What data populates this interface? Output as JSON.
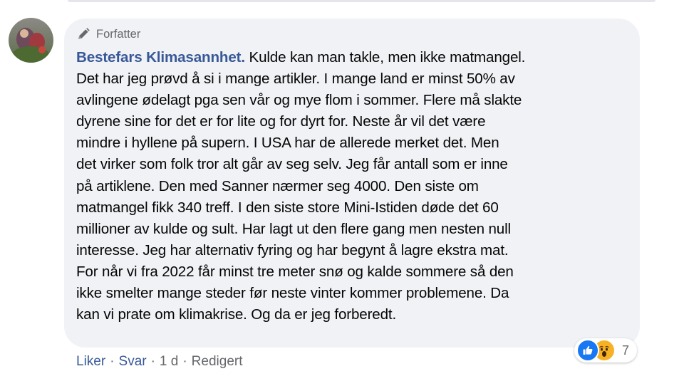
{
  "comment": {
    "badge": "Forfatter",
    "author": "Bestefars Klimasannhet.",
    "first_line_text": " Kulde kan man takle, men ikke matmangel.",
    "lines": [
      "Det har jeg prøvd å si i mange artikler. I mange land er minst 50% av",
      "avlingene ødelagt pga sen vår og mye flom i sommer. Flere må slakte",
      "dyrene sine for det er for lite og for dyrt for. Neste år vil det være",
      "mindre i hyllene på supern. I USA har de allerede merket det. Men",
      "det virker som folk tror alt går av seg selv. Jeg får antall som er inne",
      "på artiklene. Den med Sanner nærmer seg 4000. Den siste om",
      "matmangel fikk 340 treff. I den siste store Mini-Istiden døde det 60",
      "millioner av kulde og sult. Har lagt ut den flere gang men nesten null",
      "interesse. Jeg har alternativ fyring og har begynt å lagre ekstra mat.",
      "For når vi fra 2022 får minst tre meter snø og kalde sommere så den",
      "ikke smelter mange steder før neste vinter kommer problemene. Da",
      "kan vi prate om klimakrise. Og da er jeg forberedt."
    ]
  },
  "actions": {
    "like": "Liker",
    "reply": "Svar",
    "time": "1 d",
    "edited": "Redigert",
    "separator": "·"
  },
  "reactions": {
    "count": "7",
    "icons": [
      "like-icon",
      "wow-icon"
    ]
  },
  "colors": {
    "bubble": "#f0f2f5",
    "link": "#385898",
    "meta": "#65676b",
    "like": "#1877f2",
    "wow": "#f7b125"
  }
}
